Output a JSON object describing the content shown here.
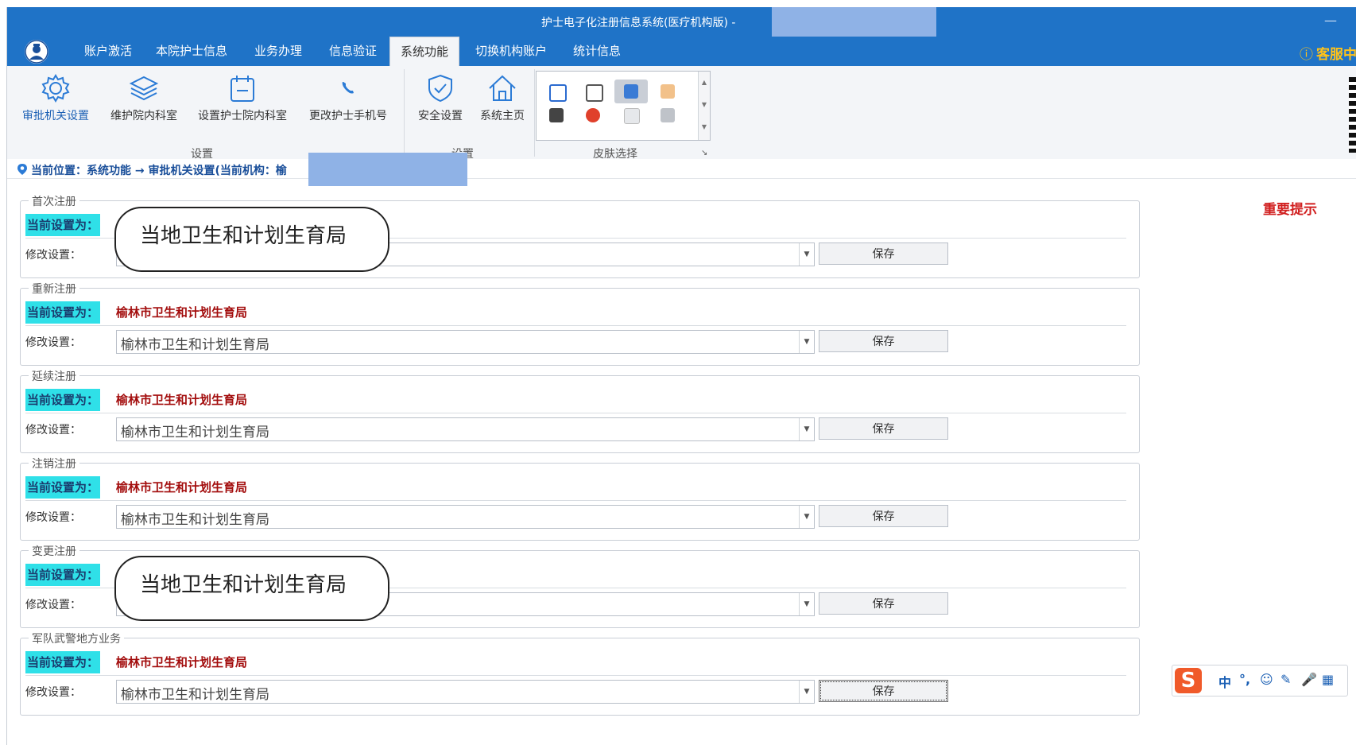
{
  "window": {
    "title": "护士电子化注册信息系统(医疗机构版) -",
    "minimize": "—"
  },
  "menu": {
    "items": [
      "账户激活",
      "本院护士信息",
      "业务办理",
      "信息验证",
      "系统功能",
      "切换机构账户",
      "统计信息"
    ],
    "active_index": 4,
    "customer_service": "客服中",
    "customer_service_icon": "ⓘ"
  },
  "ribbon": {
    "buttons": [
      {
        "label": "审批机关设置",
        "icon": "gear-icon",
        "selected": true
      },
      {
        "label": "维护院内科室",
        "icon": "layers-icon"
      },
      {
        "label": "设置护士院内科室",
        "icon": "calendar-icon"
      },
      {
        "label": "更改护士手机号",
        "icon": "phone-icon"
      },
      {
        "label": "安全设置",
        "icon": "shield-check-icon"
      },
      {
        "label": "系统主页",
        "icon": "home-icon"
      }
    ],
    "groups": [
      "设置",
      "设置",
      "皮肤选择"
    ],
    "skin_expand": "↘"
  },
  "breadcrumb": {
    "text": "当前位置：系统功能 → 审批机关设置(当前机构：榆"
  },
  "important_tip": "重要提示",
  "sections": [
    {
      "title": "首次注册",
      "current_label": "当前设置为：",
      "current_value": "",
      "modify_label": "修改设置：",
      "select_value": "",
      "save_label": "保存",
      "bubble": "当地卫生和计划生育局"
    },
    {
      "title": "重新注册",
      "current_label": "当前设置为：",
      "current_value": "榆林市卫生和计划生育局",
      "modify_label": "修改设置：",
      "select_value": "榆林市卫生和计划生育局",
      "save_label": "保存"
    },
    {
      "title": "延续注册",
      "current_label": "当前设置为：",
      "current_value": "榆林市卫生和计划生育局",
      "modify_label": "修改设置：",
      "select_value": "榆林市卫生和计划生育局",
      "save_label": "保存"
    },
    {
      "title": "注销注册",
      "current_label": "当前设置为：",
      "current_value": "榆林市卫生和计划生育局",
      "modify_label": "修改设置：",
      "select_value": "榆林市卫生和计划生育局",
      "save_label": "保存"
    },
    {
      "title": "变更注册",
      "current_label": "当前设置为：",
      "current_value": "",
      "modify_label": "修改设置：",
      "select_value": "",
      "save_label": "保存",
      "bubble": "当地卫生和计划生育局"
    },
    {
      "title": "军队武警地方业务",
      "current_label": "当前设置为：",
      "current_value": "榆林市卫生和计划生育局",
      "modify_label": "修改设置：",
      "select_value": "榆林市卫生和计划生育局",
      "save_label": "保存"
    }
  ],
  "ime": {
    "logo": "S",
    "items": [
      "中",
      "°,",
      "☺",
      "✎",
      "🎤",
      "▦"
    ]
  },
  "colors": {
    "titlebar": "#1f73c7",
    "accent_cyan": "#2fe0e8",
    "value_red": "#a30d0d",
    "tip_red": "#d12020",
    "customer_service": "#ffc21a"
  }
}
